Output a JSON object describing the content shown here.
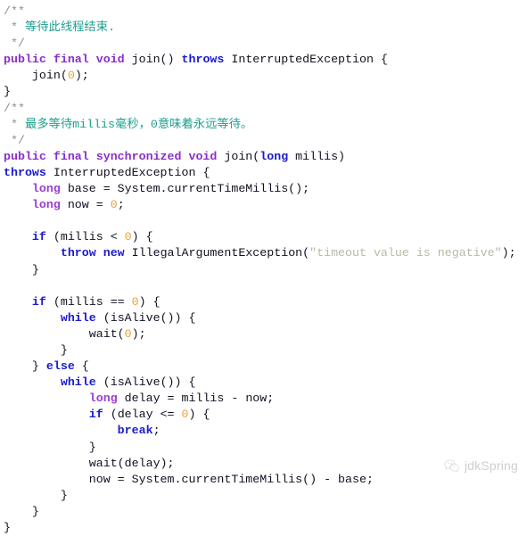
{
  "editor": {
    "language": "java",
    "background_color": "#ffffff",
    "colors": {
      "plain": "#111122",
      "keyword_modifier": "#8b2fc9",
      "keyword_control": "#1a1ad0",
      "type_primitive": "#9b3fd4",
      "number_literal": "#e8a33d",
      "string_literal": "#b9b9a8",
      "comment": "#8f8f93",
      "comment_chinese": "#1f9e8f"
    },
    "lines": [
      {
        "id": "l1",
        "tokens": [
          {
            "t": "/**",
            "c": "cmt"
          }
        ]
      },
      {
        "id": "l2",
        "tokens": [
          {
            "t": " * ",
            "c": "cmt"
          },
          {
            "t": "等待此线程结束.",
            "c": "cmtcn"
          }
        ]
      },
      {
        "id": "l3",
        "tokens": [
          {
            "t": " */",
            "c": "cmt"
          }
        ]
      },
      {
        "id": "l4",
        "tokens": [
          {
            "t": "public final void",
            "c": "kw"
          },
          {
            "t": " join() ",
            "c": "plain"
          },
          {
            "t": "throws",
            "c": "kw2"
          },
          {
            "t": " InterruptedException {",
            "c": "plain"
          }
        ]
      },
      {
        "id": "l5",
        "tokens": [
          {
            "t": "    join(",
            "c": "plain"
          },
          {
            "t": "0",
            "c": "num"
          },
          {
            "t": ");",
            "c": "plain"
          }
        ]
      },
      {
        "id": "l6",
        "tokens": [
          {
            "t": "}",
            "c": "plain"
          }
        ]
      },
      {
        "id": "l7",
        "tokens": [
          {
            "t": "/**",
            "c": "cmt"
          }
        ]
      },
      {
        "id": "l8",
        "tokens": [
          {
            "t": " * ",
            "c": "cmt"
          },
          {
            "t": "最多等待millis毫秒，0意味着永远等待。",
            "c": "cmtcn"
          }
        ]
      },
      {
        "id": "l9",
        "tokens": [
          {
            "t": " */",
            "c": "cmt"
          }
        ]
      },
      {
        "id": "l10",
        "tokens": [
          {
            "t": "public final synchronized void",
            "c": "kw"
          },
          {
            "t": " join(",
            "c": "plain"
          },
          {
            "t": "long",
            "c": "kw2"
          },
          {
            "t": " millis)",
            "c": "plain"
          }
        ]
      },
      {
        "id": "l11",
        "tokens": [
          {
            "t": "throws",
            "c": "kw2"
          },
          {
            "t": " InterruptedException {",
            "c": "plain"
          }
        ]
      },
      {
        "id": "l12",
        "tokens": [
          {
            "t": "    ",
            "c": "plain"
          },
          {
            "t": "long",
            "c": "type"
          },
          {
            "t": " base = System.currentTimeMillis();",
            "c": "plain"
          }
        ]
      },
      {
        "id": "l13",
        "tokens": [
          {
            "t": "    ",
            "c": "plain"
          },
          {
            "t": "long",
            "c": "type"
          },
          {
            "t": " now = ",
            "c": "plain"
          },
          {
            "t": "0",
            "c": "num"
          },
          {
            "t": ";",
            "c": "plain"
          }
        ]
      },
      {
        "id": "l14",
        "tokens": [
          {
            "t": "",
            "c": "plain"
          }
        ]
      },
      {
        "id": "l15",
        "tokens": [
          {
            "t": "    ",
            "c": "plain"
          },
          {
            "t": "if",
            "c": "kw2"
          },
          {
            "t": " (millis < ",
            "c": "plain"
          },
          {
            "t": "0",
            "c": "num"
          },
          {
            "t": ") {",
            "c": "plain"
          }
        ]
      },
      {
        "id": "l16",
        "tokens": [
          {
            "t": "        ",
            "c": "plain"
          },
          {
            "t": "throw new",
            "c": "kw2"
          },
          {
            "t": " IllegalArgumentException(",
            "c": "plain"
          },
          {
            "t": "\"timeout value is negative\"",
            "c": "str"
          },
          {
            "t": ");",
            "c": "plain"
          }
        ]
      },
      {
        "id": "l17",
        "tokens": [
          {
            "t": "    }",
            "c": "plain"
          }
        ]
      },
      {
        "id": "l18",
        "tokens": [
          {
            "t": "",
            "c": "plain"
          }
        ]
      },
      {
        "id": "l19",
        "tokens": [
          {
            "t": "    ",
            "c": "plain"
          },
          {
            "t": "if",
            "c": "kw2"
          },
          {
            "t": " (millis == ",
            "c": "plain"
          },
          {
            "t": "0",
            "c": "num"
          },
          {
            "t": ") {",
            "c": "plain"
          }
        ]
      },
      {
        "id": "l20",
        "tokens": [
          {
            "t": "        ",
            "c": "plain"
          },
          {
            "t": "while",
            "c": "kw2"
          },
          {
            "t": " (isAlive()) {",
            "c": "plain"
          }
        ]
      },
      {
        "id": "l21",
        "tokens": [
          {
            "t": "            wait(",
            "c": "plain"
          },
          {
            "t": "0",
            "c": "num"
          },
          {
            "t": ");",
            "c": "plain"
          }
        ]
      },
      {
        "id": "l22",
        "tokens": [
          {
            "t": "        }",
            "c": "plain"
          }
        ]
      },
      {
        "id": "l23",
        "tokens": [
          {
            "t": "    } ",
            "c": "plain"
          },
          {
            "t": "else",
            "c": "kw2"
          },
          {
            "t": " {",
            "c": "plain"
          }
        ]
      },
      {
        "id": "l24",
        "tokens": [
          {
            "t": "        ",
            "c": "plain"
          },
          {
            "t": "while",
            "c": "kw2"
          },
          {
            "t": " (isAlive()) {",
            "c": "plain"
          }
        ]
      },
      {
        "id": "l25",
        "tokens": [
          {
            "t": "            ",
            "c": "plain"
          },
          {
            "t": "long",
            "c": "type"
          },
          {
            "t": " delay = millis - now;",
            "c": "plain"
          }
        ]
      },
      {
        "id": "l26",
        "tokens": [
          {
            "t": "            ",
            "c": "plain"
          },
          {
            "t": "if",
            "c": "kw2"
          },
          {
            "t": " (delay <= ",
            "c": "plain"
          },
          {
            "t": "0",
            "c": "num"
          },
          {
            "t": ") {",
            "c": "plain"
          }
        ]
      },
      {
        "id": "l27",
        "tokens": [
          {
            "t": "                ",
            "c": "plain"
          },
          {
            "t": "break",
            "c": "kw2"
          },
          {
            "t": ";",
            "c": "plain"
          }
        ]
      },
      {
        "id": "l28",
        "tokens": [
          {
            "t": "            }",
            "c": "plain"
          }
        ]
      },
      {
        "id": "l29",
        "tokens": [
          {
            "t": "            wait(delay);",
            "c": "plain"
          }
        ]
      },
      {
        "id": "l30",
        "tokens": [
          {
            "t": "            now = System.currentTimeMillis() - base;",
            "c": "plain"
          }
        ]
      },
      {
        "id": "l31",
        "tokens": [
          {
            "t": "        }",
            "c": "plain"
          }
        ]
      },
      {
        "id": "l32",
        "tokens": [
          {
            "t": "    }",
            "c": "plain"
          }
        ]
      },
      {
        "id": "l33",
        "tokens": [
          {
            "t": "}",
            "c": "plain"
          }
        ]
      }
    ]
  },
  "watermark": {
    "icon": "wechat-icon",
    "label": "jdkSpring",
    "color": "#b5b5b5"
  }
}
